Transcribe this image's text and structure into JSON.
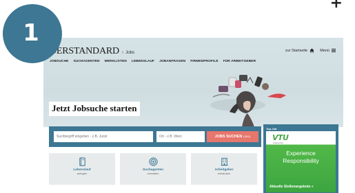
{
  "step": {
    "number": "1"
  },
  "corner": {
    "plus": "+"
  },
  "header": {
    "logo": "DERSTANDARD",
    "logo_separator": "›",
    "logo_section": "Jobs",
    "home_link": "zur Startseite",
    "menu_label": "Menü"
  },
  "nav": {
    "items": [
      "JOBSUCHE",
      "SUCHAGENTEN",
      "MERKLISTEN",
      "LEBENSLAUF",
      "JOBANFRAGEN",
      "FIRMENPROFILE",
      "FÜR ARBEITGEBER"
    ]
  },
  "hero": {
    "title": "Jetzt Jobsuche starten"
  },
  "search": {
    "keyword_placeholder": "Suchbegriff eingeben - z.B. Jurist",
    "location_placeholder": "Ort - z.B. Wien",
    "button_label": "JOBS SUCHEN",
    "button_count": "(3903)"
  },
  "tiles": [
    {
      "title": "Lebenslauf",
      "subtitle": "anlegen",
      "icon": "document-icon"
    },
    {
      "title": "Suchagenten",
      "subtitle": "verwalten",
      "icon": "target-icon"
    },
    {
      "title": "Arbeitgeber",
      "subtitle": "entdecken",
      "icon": "building-icon"
    }
  ],
  "ad": {
    "label": "Top-Job",
    "brand": "VTU",
    "brand_tagline": "engineering",
    "line1": "Experience",
    "line2": "Responsibility",
    "link": "Aktuelle Stellenangebote »"
  },
  "colors": {
    "accent": "#3d7793",
    "button": "#e7766d",
    "tile_bg": "#e7ebec",
    "ad_green": "#51b948"
  }
}
